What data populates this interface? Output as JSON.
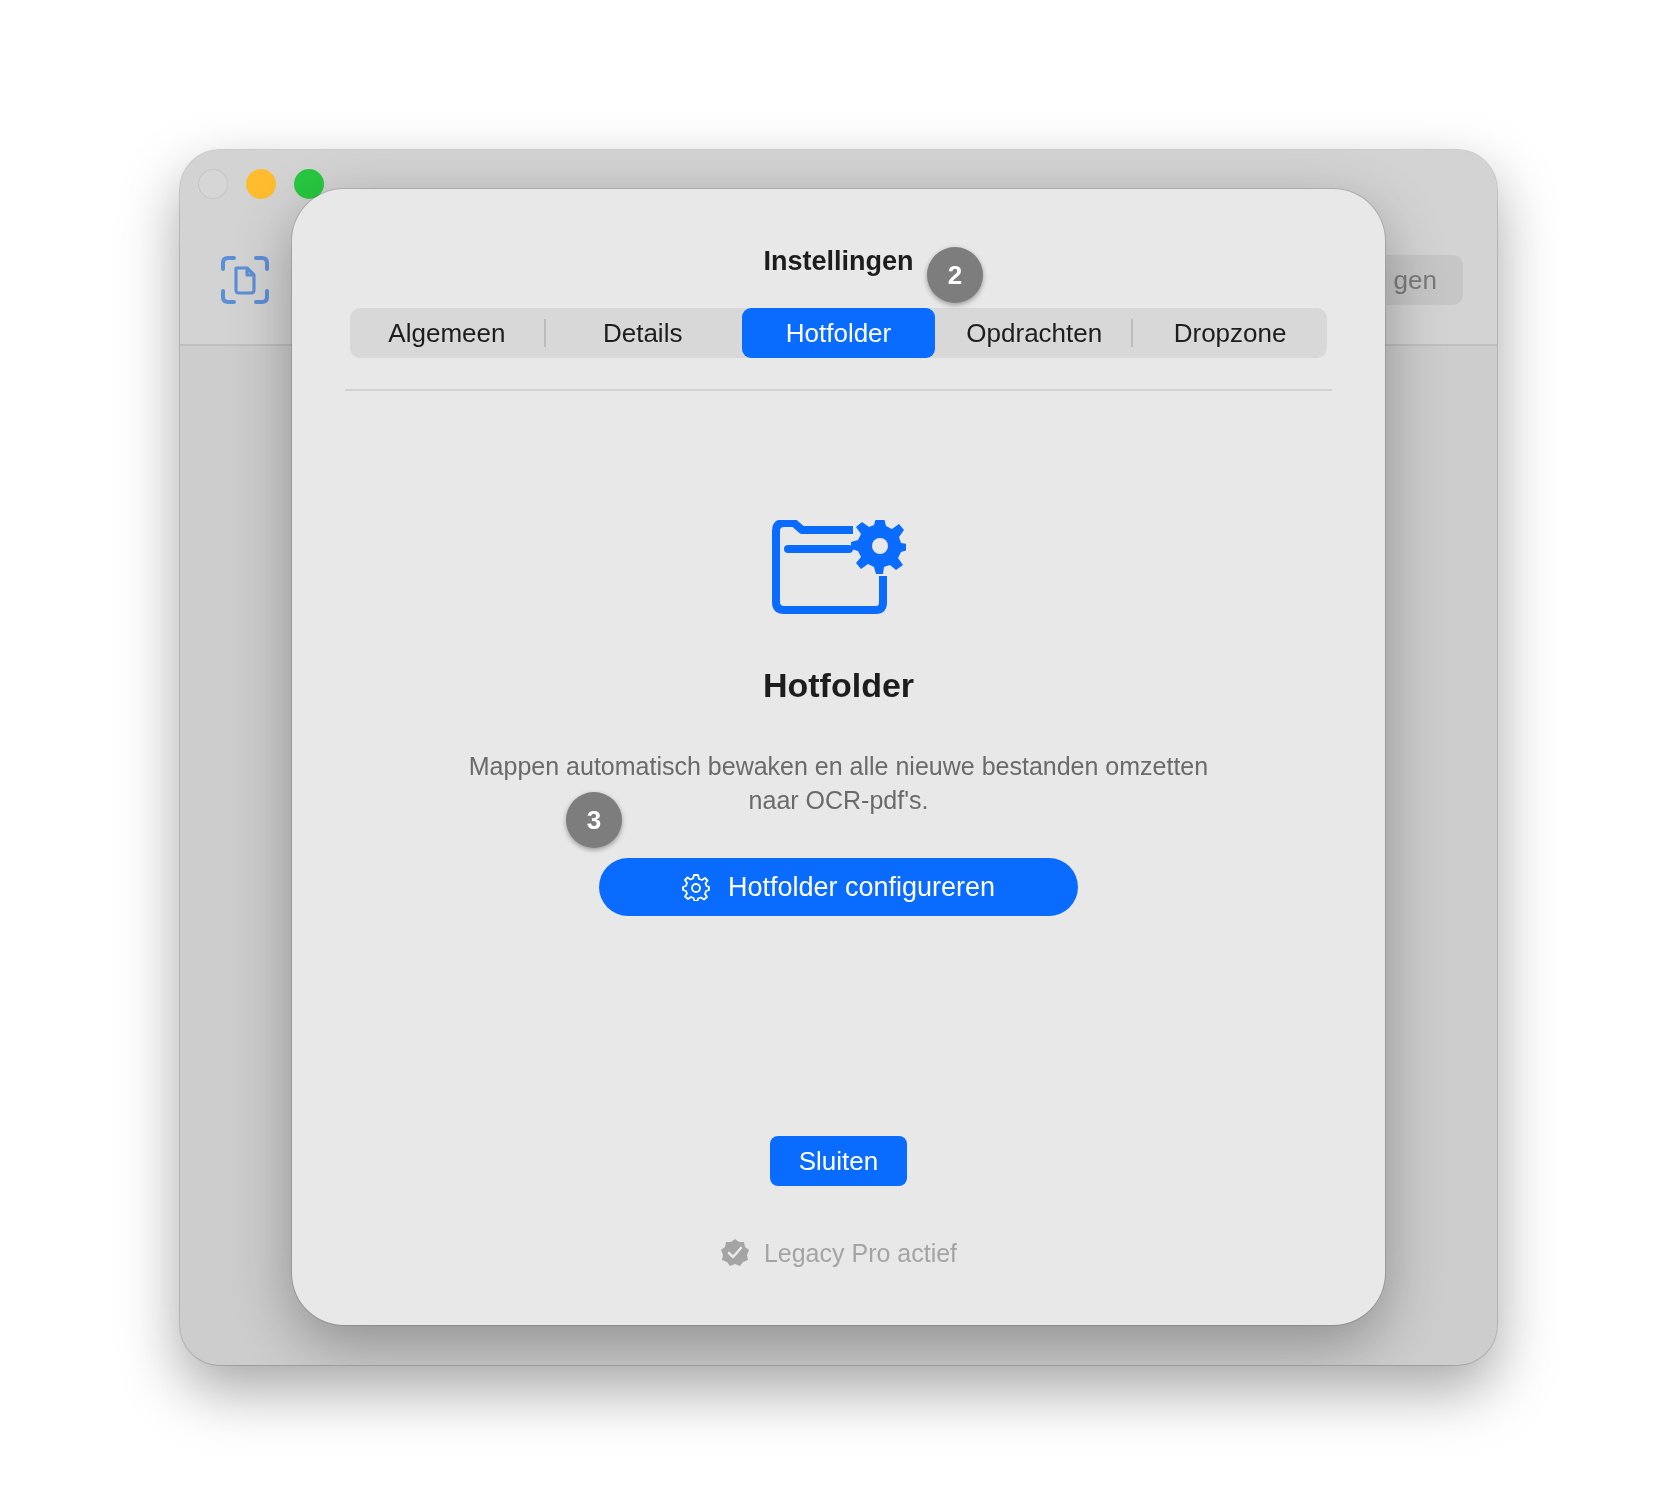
{
  "window": {
    "controls": [
      {
        "kind": "close",
        "disabled": true
      },
      {
        "kind": "minimize",
        "disabled": false
      },
      {
        "kind": "zoom",
        "disabled": false
      }
    ],
    "toolbar": {
      "button_label": "gen"
    }
  },
  "sheet": {
    "title": "Instellingen",
    "title_badge": "2",
    "tabs": [
      {
        "label": "Algemeen",
        "selected": false
      },
      {
        "label": "Details",
        "selected": false
      },
      {
        "label": "Hotfolder",
        "selected": true
      },
      {
        "label": "Opdrachten",
        "selected": false
      },
      {
        "label": "Dropzone",
        "selected": false
      }
    ],
    "heading": "Hotfolder",
    "description": "Mappen automatisch bewaken en alle nieuwe bestanden omzetten naar OCR-pdf's.",
    "action_button": {
      "label": "Hotfolder configureren",
      "badge": "3"
    },
    "close_button": "Sluiten",
    "license_status": "Legacy Pro actief"
  }
}
